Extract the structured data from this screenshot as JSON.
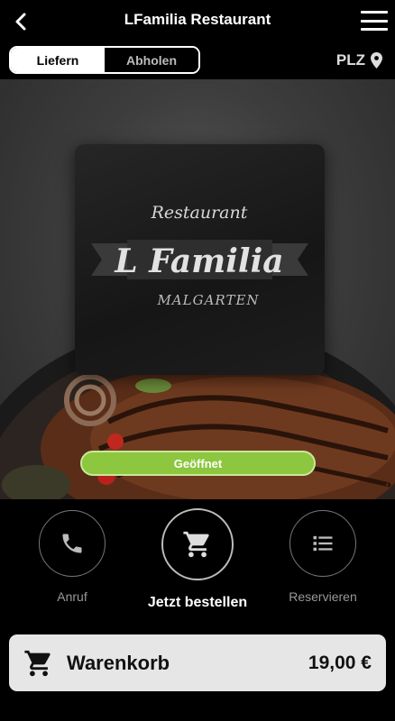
{
  "header": {
    "title": "LFamilia Restaurant",
    "back_icon": "chevron-left-icon",
    "menu_icon": "hamburger-menu-icon"
  },
  "mode": {
    "deliver_label": "Liefern",
    "pickup_label": "Abholen",
    "selected": "Liefern"
  },
  "location": {
    "label": "PLZ",
    "icon": "map-pin-icon"
  },
  "hero": {
    "logo": {
      "top_text": "Restaurant",
      "name": "L Familia",
      "sub_text": "MALGARTEN"
    },
    "status_label": "Geöffnet",
    "status_color": "#8dc63f"
  },
  "actions": [
    {
      "label": "Anruf",
      "icon": "phone-icon"
    },
    {
      "label": "Jetzt bestellen",
      "icon": "cart-icon"
    },
    {
      "label": "Reservieren",
      "icon": "list-icon"
    }
  ],
  "cart": {
    "label": "Warenkorb",
    "total": "19,00 €",
    "icon": "cart-icon"
  }
}
